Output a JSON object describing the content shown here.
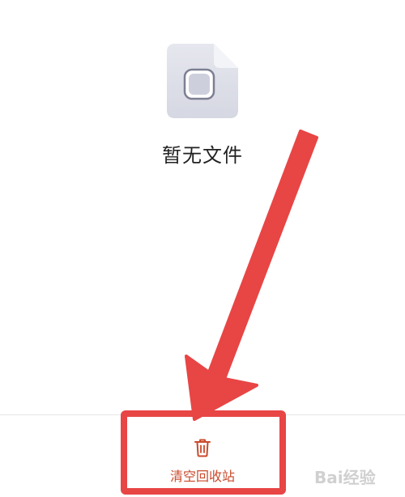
{
  "empty_state": {
    "icon": "file-icon",
    "message": "暂无文件"
  },
  "bottom_bar": {
    "clear_bin": {
      "icon": "trash-icon",
      "label": "清空回收站",
      "color": "#c94a2c"
    }
  },
  "annotation": {
    "color": "#e84545"
  },
  "watermark": {
    "text": "Bai经验"
  }
}
